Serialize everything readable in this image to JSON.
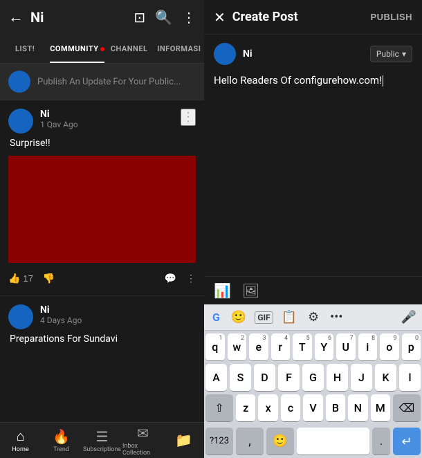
{
  "app": {
    "title": "Ni"
  },
  "tabs": [
    {
      "label": "LIST!",
      "active": false
    },
    {
      "label": "COMMUNITY",
      "active": true,
      "dot": true
    },
    {
      "label": "CHANNEL",
      "active": false
    },
    {
      "label": "INFORMASI",
      "active": false
    }
  ],
  "publish_bar": {
    "placeholder": "Publish An Update For Your Public..."
  },
  "post1": {
    "author": "Ni",
    "time": "1 Qav Ago",
    "text": "Surprise!!",
    "likes": "17"
  },
  "post2": {
    "author": "Ni",
    "time": "4 Days Ago",
    "text": "Preparations For Sundavi"
  },
  "bottom_nav": [
    {
      "label": "Home",
      "icon": "⌂",
      "active": true
    },
    {
      "label": "Trend",
      "icon": "🔥",
      "active": false
    },
    {
      "label": "Subscriptions",
      "icon": "📋",
      "active": false
    },
    {
      "label": "Inbox Collection",
      "icon": "✉",
      "active": false
    },
    {
      "label": "",
      "icon": "📁",
      "active": false
    }
  ],
  "create_post": {
    "title": "Create Post",
    "publish_label": "PUBLISH",
    "user": "Ni",
    "audience": "Public",
    "content": "Hello Readers Of configurehow.com!"
  },
  "keyboard": {
    "rows": [
      [
        {
          "char": "q",
          "sup": "1"
        },
        {
          "char": "w",
          "sup": "2"
        },
        {
          "char": "e",
          "sup": "3"
        },
        {
          "char": "r",
          "sup": "4"
        },
        {
          "char": "T",
          "sup": "5"
        },
        {
          "char": "Y",
          "sup": "6"
        },
        {
          "char": "U",
          "sup": "7"
        },
        {
          "char": "i",
          "sup": "8"
        },
        {
          "char": "o",
          "sup": "9"
        },
        {
          "char": "p",
          "sup": "0"
        }
      ],
      [
        {
          "char": "A"
        },
        {
          "char": "S"
        },
        {
          "char": "D"
        },
        {
          "char": "F"
        },
        {
          "char": "G"
        },
        {
          "char": "H"
        },
        {
          "char": "J"
        },
        {
          "char": "K"
        },
        {
          "char": "l"
        }
      ],
      [
        {
          "char": "⇧",
          "dark": true,
          "wide": true
        },
        {
          "char": "z"
        },
        {
          "char": "x"
        },
        {
          "char": "c"
        },
        {
          "char": "V"
        },
        {
          "char": "B"
        },
        {
          "char": "N"
        },
        {
          "char": "M"
        },
        {
          "char": "⌫",
          "dark": true,
          "wide": true
        }
      ]
    ],
    "bottom": {
      "num_label": "?123",
      "comma": ",",
      "period": ".",
      "enter_icon": "↵"
    }
  }
}
